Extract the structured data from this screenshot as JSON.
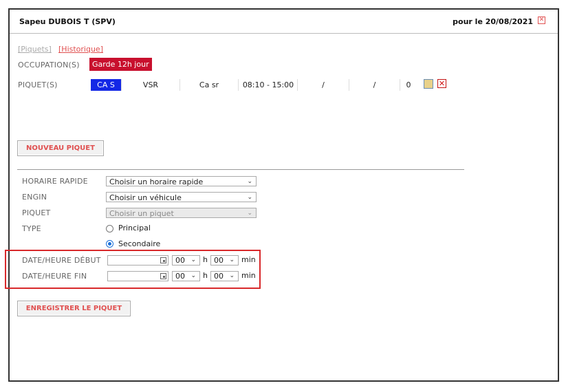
{
  "header": {
    "name": "Sapeu DUBOIS T (SPV)",
    "date_prefix": "pour le 20/08/2021"
  },
  "links": {
    "piquets": "[Piquets]",
    "historique": "[Historique]"
  },
  "occupation": {
    "label": "OCCUPATION(S)",
    "value": "Garde 12h jour"
  },
  "piquet_row": {
    "label": "PIQUET(S)",
    "cells": [
      "CA S",
      "VSR",
      "Ca sr",
      "08:10 - 15:00",
      "/",
      "/",
      "0"
    ]
  },
  "buttons": {
    "nouveau": "NOUVEAU PIQUET",
    "enregistrer": "ENREGISTRER LE PIQUET"
  },
  "form": {
    "horaire_label": "HORAIRE RAPIDE",
    "horaire_value": "Choisir un horaire rapide",
    "engin_label": "ENGIN",
    "engin_value": "Choisir un véhicule",
    "piquet_label": "PIQUET",
    "piquet_value": "Choisir un piquet",
    "type_label": "TYPE",
    "type_principal": "Principal",
    "type_secondaire": "Secondaire",
    "debut_label": "DATE/HEURE DÉBUT",
    "fin_label": "DATE/HEURE FIN",
    "hour_value": "00",
    "min_value": "00",
    "h_unit": "h",
    "min_unit": "min"
  },
  "icons": {
    "close": "close-icon",
    "edit": "edit-icon",
    "delete": "delete-icon",
    "calendar": "calendar-icon",
    "chevron": "chevron-down-icon"
  },
  "colors": {
    "garde": "#c8102e",
    "cas": "#1428e6",
    "link_red": "#e05050",
    "highlight": "#d8282a",
    "radio": "#1a6fd8"
  }
}
